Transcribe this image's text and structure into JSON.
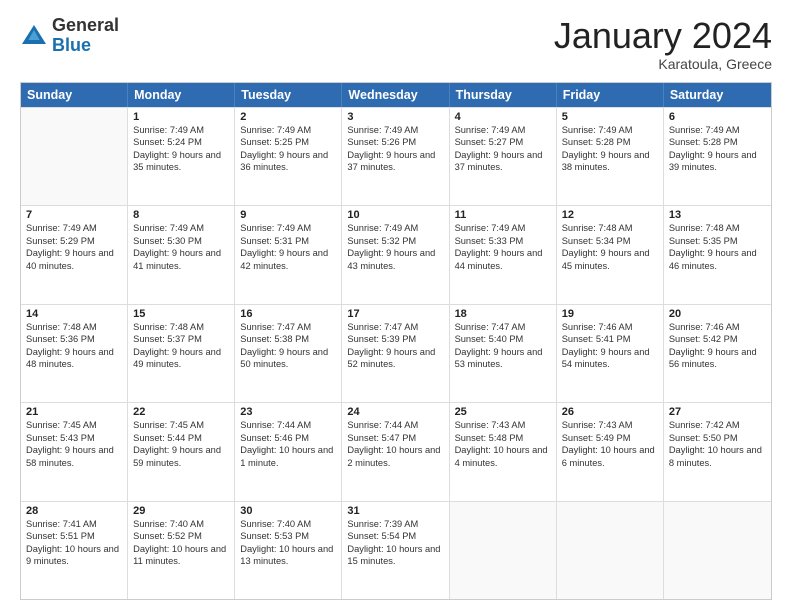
{
  "header": {
    "logo_general": "General",
    "logo_blue": "Blue",
    "month_title": "January 2024",
    "location": "Karatoula, Greece"
  },
  "days_of_week": [
    "Sunday",
    "Monday",
    "Tuesday",
    "Wednesday",
    "Thursday",
    "Friday",
    "Saturday"
  ],
  "weeks": [
    [
      {
        "day": "",
        "sunrise": "",
        "sunset": "",
        "daylight": ""
      },
      {
        "day": "1",
        "sunrise": "Sunrise: 7:49 AM",
        "sunset": "Sunset: 5:24 PM",
        "daylight": "Daylight: 9 hours and 35 minutes."
      },
      {
        "day": "2",
        "sunrise": "Sunrise: 7:49 AM",
        "sunset": "Sunset: 5:25 PM",
        "daylight": "Daylight: 9 hours and 36 minutes."
      },
      {
        "day": "3",
        "sunrise": "Sunrise: 7:49 AM",
        "sunset": "Sunset: 5:26 PM",
        "daylight": "Daylight: 9 hours and 37 minutes."
      },
      {
        "day": "4",
        "sunrise": "Sunrise: 7:49 AM",
        "sunset": "Sunset: 5:27 PM",
        "daylight": "Daylight: 9 hours and 37 minutes."
      },
      {
        "day": "5",
        "sunrise": "Sunrise: 7:49 AM",
        "sunset": "Sunset: 5:28 PM",
        "daylight": "Daylight: 9 hours and 38 minutes."
      },
      {
        "day": "6",
        "sunrise": "Sunrise: 7:49 AM",
        "sunset": "Sunset: 5:28 PM",
        "daylight": "Daylight: 9 hours and 39 minutes."
      }
    ],
    [
      {
        "day": "7",
        "sunrise": "Sunrise: 7:49 AM",
        "sunset": "Sunset: 5:29 PM",
        "daylight": "Daylight: 9 hours and 40 minutes."
      },
      {
        "day": "8",
        "sunrise": "Sunrise: 7:49 AM",
        "sunset": "Sunset: 5:30 PM",
        "daylight": "Daylight: 9 hours and 41 minutes."
      },
      {
        "day": "9",
        "sunrise": "Sunrise: 7:49 AM",
        "sunset": "Sunset: 5:31 PM",
        "daylight": "Daylight: 9 hours and 42 minutes."
      },
      {
        "day": "10",
        "sunrise": "Sunrise: 7:49 AM",
        "sunset": "Sunset: 5:32 PM",
        "daylight": "Daylight: 9 hours and 43 minutes."
      },
      {
        "day": "11",
        "sunrise": "Sunrise: 7:49 AM",
        "sunset": "Sunset: 5:33 PM",
        "daylight": "Daylight: 9 hours and 44 minutes."
      },
      {
        "day": "12",
        "sunrise": "Sunrise: 7:48 AM",
        "sunset": "Sunset: 5:34 PM",
        "daylight": "Daylight: 9 hours and 45 minutes."
      },
      {
        "day": "13",
        "sunrise": "Sunrise: 7:48 AM",
        "sunset": "Sunset: 5:35 PM",
        "daylight": "Daylight: 9 hours and 46 minutes."
      }
    ],
    [
      {
        "day": "14",
        "sunrise": "Sunrise: 7:48 AM",
        "sunset": "Sunset: 5:36 PM",
        "daylight": "Daylight: 9 hours and 48 minutes."
      },
      {
        "day": "15",
        "sunrise": "Sunrise: 7:48 AM",
        "sunset": "Sunset: 5:37 PM",
        "daylight": "Daylight: 9 hours and 49 minutes."
      },
      {
        "day": "16",
        "sunrise": "Sunrise: 7:47 AM",
        "sunset": "Sunset: 5:38 PM",
        "daylight": "Daylight: 9 hours and 50 minutes."
      },
      {
        "day": "17",
        "sunrise": "Sunrise: 7:47 AM",
        "sunset": "Sunset: 5:39 PM",
        "daylight": "Daylight: 9 hours and 52 minutes."
      },
      {
        "day": "18",
        "sunrise": "Sunrise: 7:47 AM",
        "sunset": "Sunset: 5:40 PM",
        "daylight": "Daylight: 9 hours and 53 minutes."
      },
      {
        "day": "19",
        "sunrise": "Sunrise: 7:46 AM",
        "sunset": "Sunset: 5:41 PM",
        "daylight": "Daylight: 9 hours and 54 minutes."
      },
      {
        "day": "20",
        "sunrise": "Sunrise: 7:46 AM",
        "sunset": "Sunset: 5:42 PM",
        "daylight": "Daylight: 9 hours and 56 minutes."
      }
    ],
    [
      {
        "day": "21",
        "sunrise": "Sunrise: 7:45 AM",
        "sunset": "Sunset: 5:43 PM",
        "daylight": "Daylight: 9 hours and 58 minutes."
      },
      {
        "day": "22",
        "sunrise": "Sunrise: 7:45 AM",
        "sunset": "Sunset: 5:44 PM",
        "daylight": "Daylight: 9 hours and 59 minutes."
      },
      {
        "day": "23",
        "sunrise": "Sunrise: 7:44 AM",
        "sunset": "Sunset: 5:46 PM",
        "daylight": "Daylight: 10 hours and 1 minute."
      },
      {
        "day": "24",
        "sunrise": "Sunrise: 7:44 AM",
        "sunset": "Sunset: 5:47 PM",
        "daylight": "Daylight: 10 hours and 2 minutes."
      },
      {
        "day": "25",
        "sunrise": "Sunrise: 7:43 AM",
        "sunset": "Sunset: 5:48 PM",
        "daylight": "Daylight: 10 hours and 4 minutes."
      },
      {
        "day": "26",
        "sunrise": "Sunrise: 7:43 AM",
        "sunset": "Sunset: 5:49 PM",
        "daylight": "Daylight: 10 hours and 6 minutes."
      },
      {
        "day": "27",
        "sunrise": "Sunrise: 7:42 AM",
        "sunset": "Sunset: 5:50 PM",
        "daylight": "Daylight: 10 hours and 8 minutes."
      }
    ],
    [
      {
        "day": "28",
        "sunrise": "Sunrise: 7:41 AM",
        "sunset": "Sunset: 5:51 PM",
        "daylight": "Daylight: 10 hours and 9 minutes."
      },
      {
        "day": "29",
        "sunrise": "Sunrise: 7:40 AM",
        "sunset": "Sunset: 5:52 PM",
        "daylight": "Daylight: 10 hours and 11 minutes."
      },
      {
        "day": "30",
        "sunrise": "Sunrise: 7:40 AM",
        "sunset": "Sunset: 5:53 PM",
        "daylight": "Daylight: 10 hours and 13 minutes."
      },
      {
        "day": "31",
        "sunrise": "Sunrise: 7:39 AM",
        "sunset": "Sunset: 5:54 PM",
        "daylight": "Daylight: 10 hours and 15 minutes."
      },
      {
        "day": "",
        "sunrise": "",
        "sunset": "",
        "daylight": ""
      },
      {
        "day": "",
        "sunrise": "",
        "sunset": "",
        "daylight": ""
      },
      {
        "day": "",
        "sunrise": "",
        "sunset": "",
        "daylight": ""
      }
    ]
  ]
}
